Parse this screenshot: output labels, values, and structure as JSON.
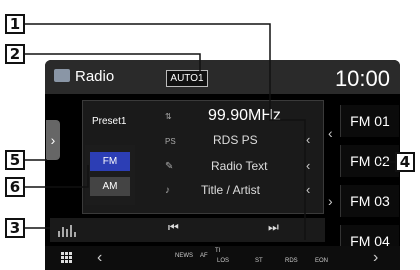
{
  "header": {
    "title": "Radio",
    "seek_mode": "AUTO1",
    "clock": "10:00"
  },
  "info": {
    "preset": "Preset1",
    "frequency": "99.90MHz",
    "ps_label": "PS",
    "ps": "RDS PS",
    "radio_text": "Radio Text",
    "title_artist": "Title / Artist"
  },
  "bands": {
    "fm": "FM",
    "am": "AM"
  },
  "presets": [
    "FM 01",
    "FM 02",
    "FM 03",
    "FM 04"
  ],
  "controls": {
    "prev": "⏮",
    "next": "⏭"
  },
  "status": {
    "news": "NEWS",
    "af": "AF",
    "ti": "TI",
    "los": "LOS",
    "st": "ST",
    "rds": "RDS",
    "eon": "EON"
  },
  "callouts": [
    "1",
    "2",
    "3",
    "4",
    "5",
    "6"
  ]
}
